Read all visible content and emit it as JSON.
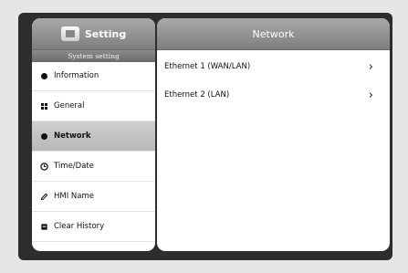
{
  "sidebar": {
    "title": "Setting",
    "subtitle": "System setting",
    "items": [
      {
        "label": "Information",
        "icon": "info-icon"
      },
      {
        "label": "General",
        "icon": "grid-icon"
      },
      {
        "label": "Network",
        "icon": "network-icon",
        "selected": true
      },
      {
        "label": "Time/Date",
        "icon": "clock-icon"
      },
      {
        "label": "HMI Name",
        "icon": "pencil-icon"
      },
      {
        "label": "Clear History",
        "icon": "clear-history-icon"
      }
    ]
  },
  "main": {
    "title": "Network",
    "rows": [
      {
        "label": "Ethernet 1 (WAN/LAN)",
        "chevron": "›"
      },
      {
        "label": "Ethernet 2 (LAN)",
        "chevron": "›"
      }
    ]
  }
}
